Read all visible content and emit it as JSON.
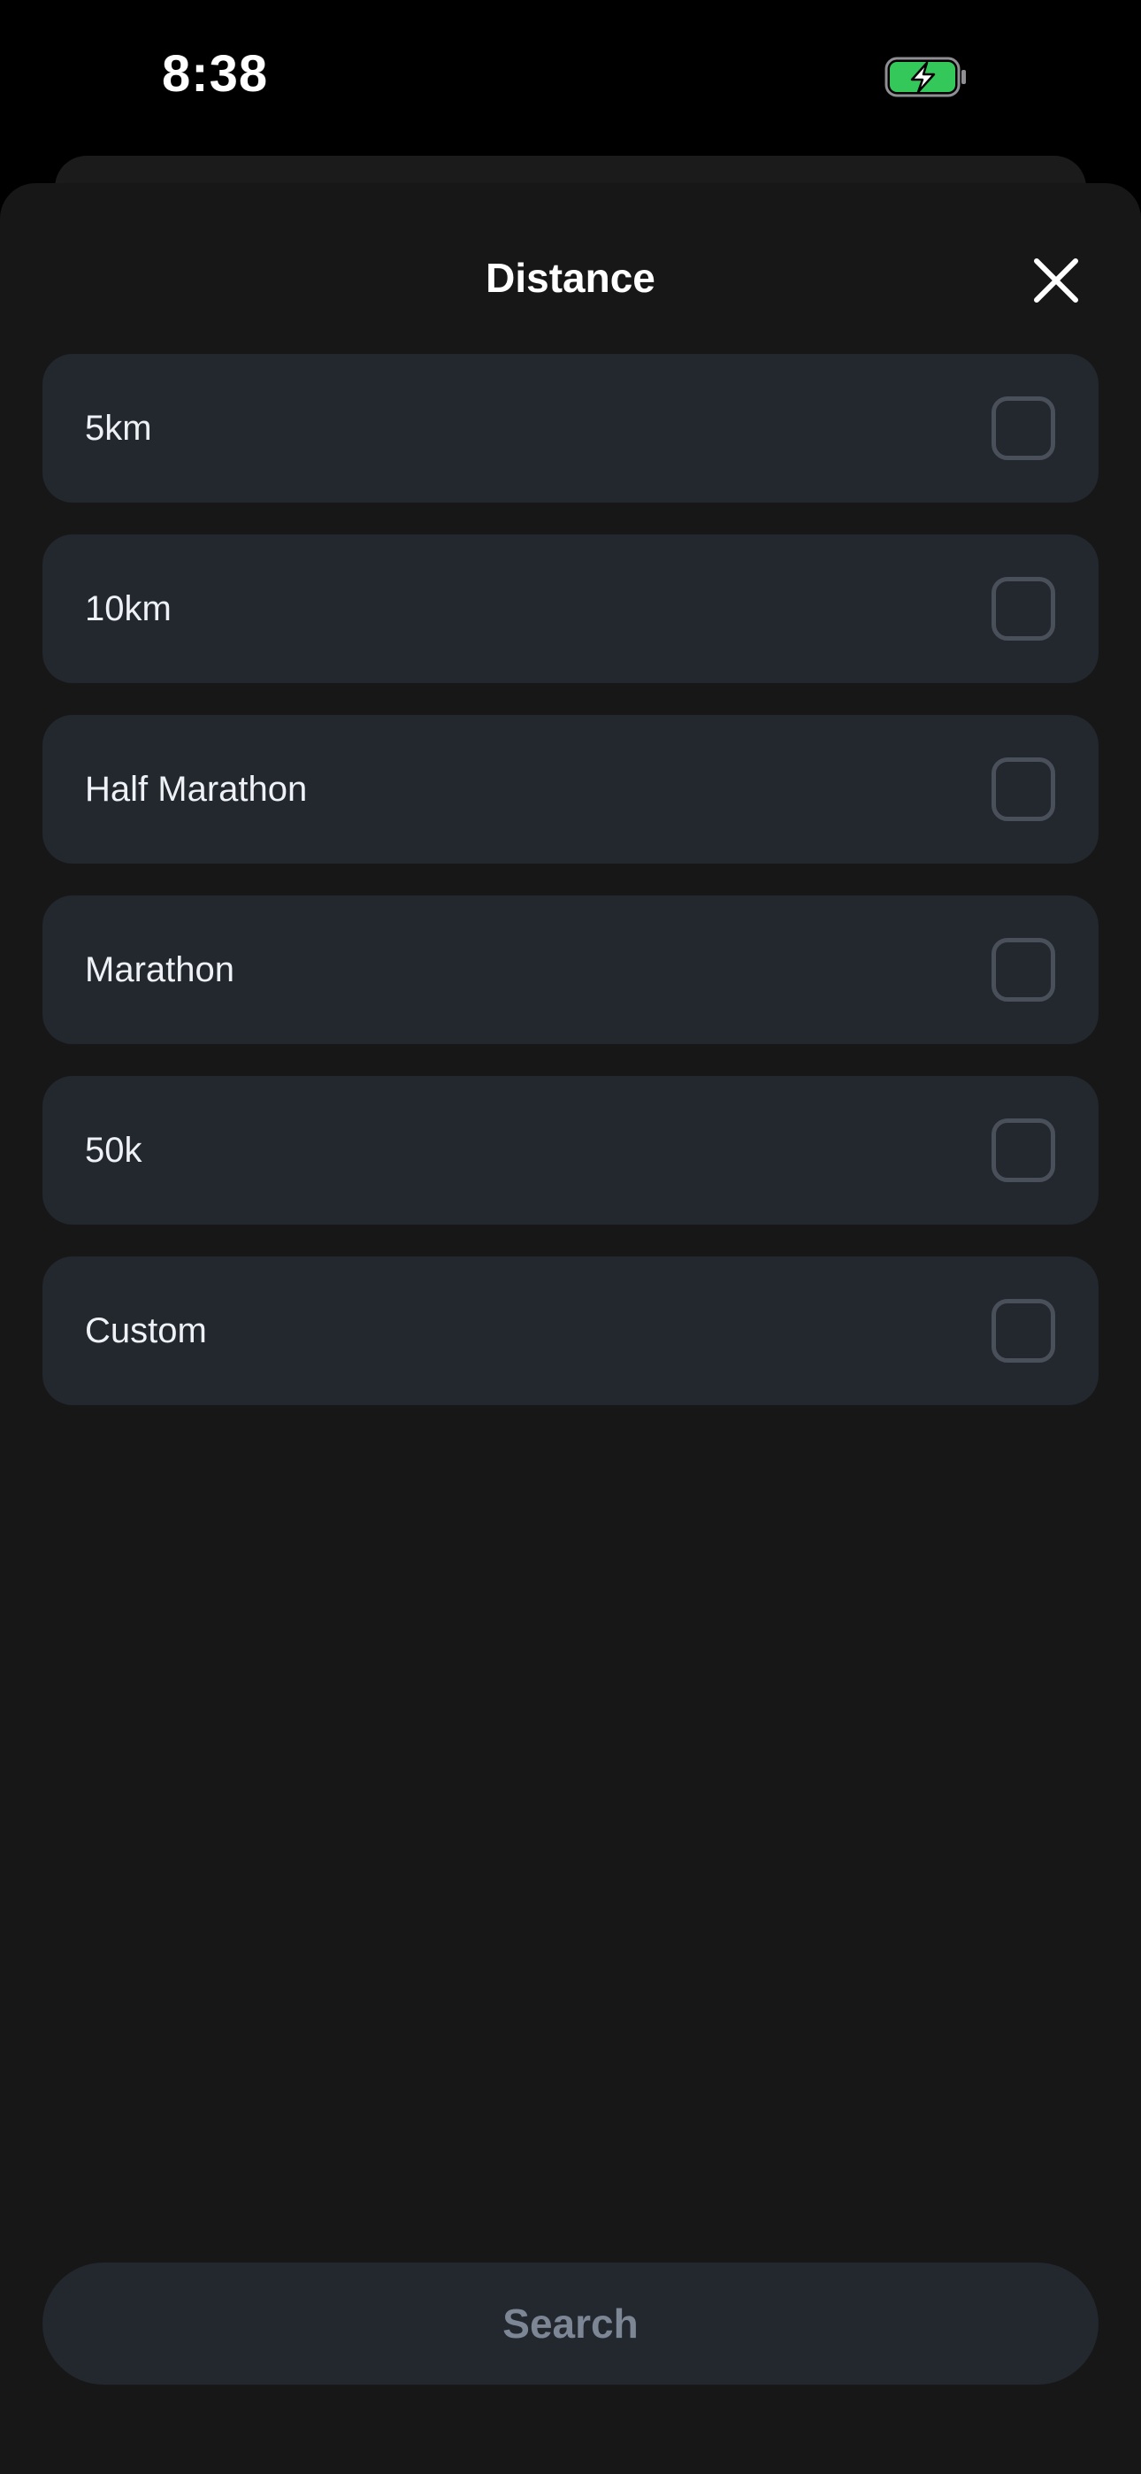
{
  "status_bar": {
    "time": "8:38",
    "battery_icon": "battery-charging-icon",
    "battery_color": "#34c759"
  },
  "sheet": {
    "title": "Distance",
    "close_icon": "close-icon",
    "options": [
      {
        "label": "5km",
        "checked": false
      },
      {
        "label": "10km",
        "checked": false
      },
      {
        "label": "Half Marathon",
        "checked": false
      },
      {
        "label": "Marathon",
        "checked": false
      },
      {
        "label": "50k",
        "checked": false
      },
      {
        "label": "Custom",
        "checked": false
      }
    ],
    "search_label": "Search"
  },
  "colors": {
    "background": "#171717",
    "card": "#23272e",
    "checkbox_border": "#4a5059",
    "button_text_disabled": "#7c8694"
  }
}
